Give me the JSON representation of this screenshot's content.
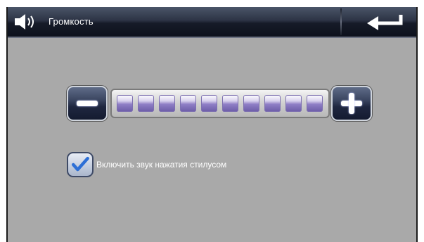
{
  "header": {
    "title": "Громкость",
    "speaker_icon": "speaker-icon",
    "back_icon": "back-arrow-icon"
  },
  "volume": {
    "minus_icon": "minus-icon",
    "plus_icon": "plus-icon",
    "level_segments_filled": 10,
    "level_segments_total": 10
  },
  "stylus_sound": {
    "label": "Включить звук нажатия стилусом",
    "checked": true,
    "check_icon": "checkmark-icon"
  },
  "colors": {
    "background": "#a9a9a9",
    "header": "#1c2231",
    "segment": "#7a6bb6",
    "button": "#2a3450"
  }
}
